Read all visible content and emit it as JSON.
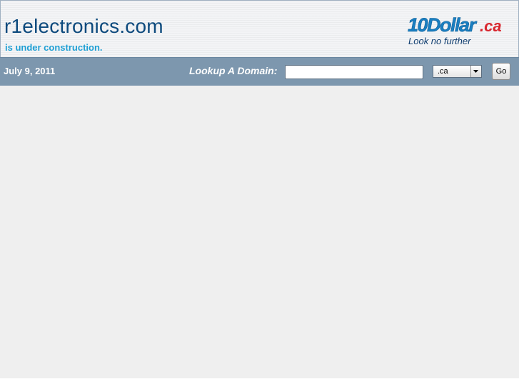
{
  "header": {
    "site_title": "r1electronics.com",
    "site_subtitle": "is under construction."
  },
  "logo": {
    "brand_main": "10Dollar",
    "brand_tld": ".ca",
    "tagline": "Look no further",
    "colors": {
      "main": "#1a7fc1",
      "tld": "#d8262e",
      "tagline": "#0f3d6f"
    }
  },
  "toolbar": {
    "date": "July 9, 2011",
    "lookup_label": "Lookup A Domain:",
    "domain_input_value": "",
    "tld_selected": ".ca",
    "go_label": "Go"
  },
  "colors": {
    "title": "#0d4a7d",
    "subtitle": "#1e9fd4",
    "toolbar_bg": "#7d97ae",
    "page_bg": "#efefef"
  }
}
